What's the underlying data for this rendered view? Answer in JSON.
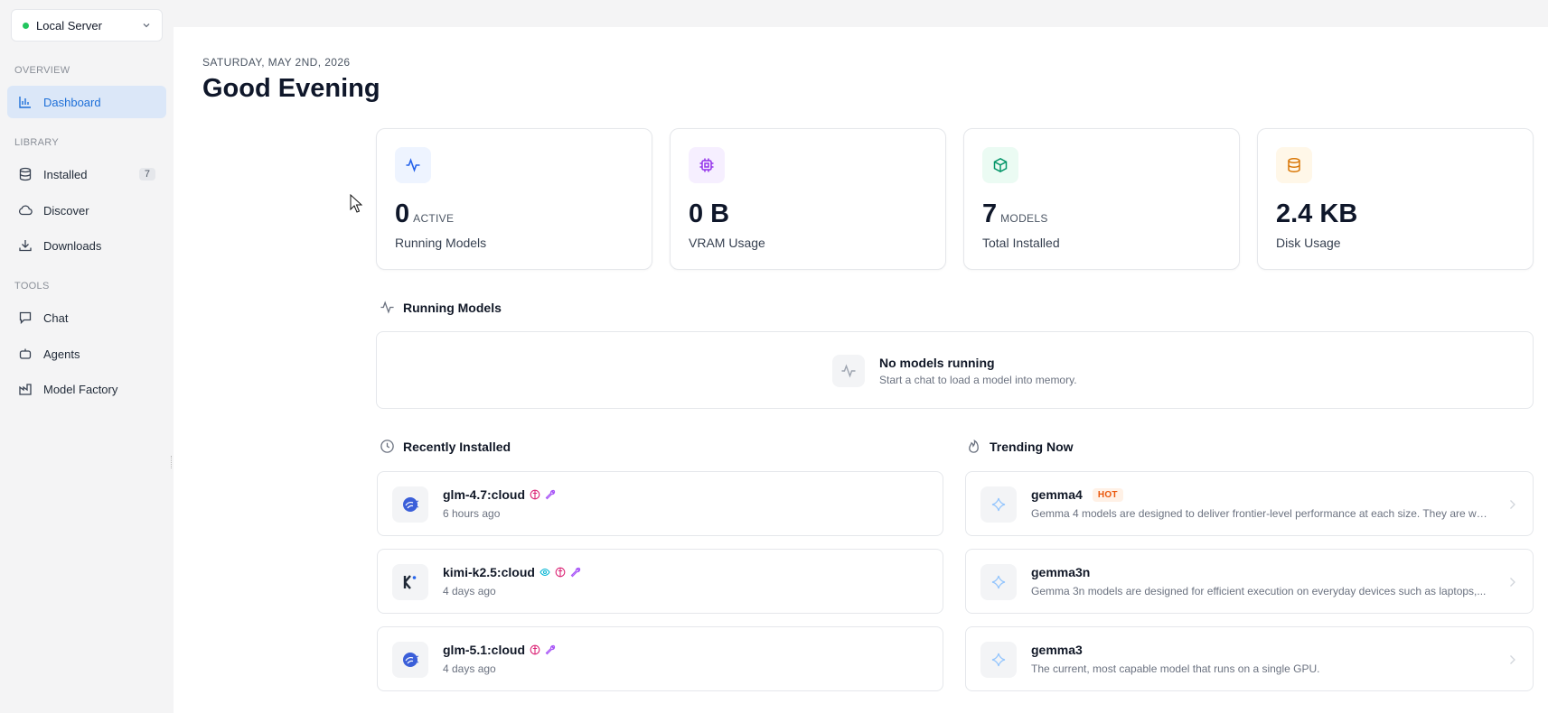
{
  "server": {
    "name": "Local Server",
    "status_color": "#22c55e"
  },
  "sidebar": {
    "sections": [
      {
        "title": "OVERVIEW"
      },
      {
        "title": "LIBRARY"
      },
      {
        "title": "TOOLS"
      }
    ],
    "items": [
      {
        "label": "Dashboard",
        "icon": "chart-bar-icon",
        "active": true
      },
      {
        "label": "Installed",
        "icon": "database-icon",
        "count": "7"
      },
      {
        "label": "Discover",
        "icon": "cloud-icon"
      },
      {
        "label": "Downloads",
        "icon": "download-icon"
      },
      {
        "label": "Chat",
        "icon": "message-icon"
      },
      {
        "label": "Agents",
        "icon": "bot-icon"
      },
      {
        "label": "Model Factory",
        "icon": "factory-icon"
      }
    ]
  },
  "header": {
    "date": "SATURDAY, MAY 2ND, 2026",
    "greeting": "Good Evening"
  },
  "stats": [
    {
      "value": "0",
      "unit": "ACTIVE",
      "label": "Running Models",
      "icon": "activity-icon",
      "color": "#2563eb",
      "bg": "#eef4ff"
    },
    {
      "value": "0 B",
      "unit": "",
      "label": "VRAM Usage",
      "icon": "chip-icon",
      "color": "#9333ea",
      "bg": "#f6efff"
    },
    {
      "value": "7",
      "unit": "MODELS",
      "label": "Total Installed",
      "icon": "box-icon",
      "color": "#059669",
      "bg": "#ebfbf3"
    },
    {
      "value": "2.4 KB",
      "unit": "",
      "label": "Disk Usage",
      "icon": "database-icon",
      "color": "#d97706",
      "bg": "#fff7e8"
    }
  ],
  "running": {
    "title": "Running Models",
    "empty_title": "No models running",
    "empty_subtitle": "Start a chat to load a model into memory."
  },
  "recent": {
    "title": "Recently Installed",
    "items": [
      {
        "name": "glm-4.7:cloud",
        "time": "6 hours ago",
        "icon": "glm-logo-icon"
      },
      {
        "name": "kimi-k2.5:cloud",
        "time": "4 days ago",
        "icon": "kimi-logo-icon"
      },
      {
        "name": "glm-5.1:cloud",
        "time": "4 days ago",
        "icon": "glm-logo-icon"
      }
    ]
  },
  "trending": {
    "title": "Trending Now",
    "hot_label": "HOT",
    "items": [
      {
        "name": "gemma4",
        "hot": true,
        "description": "Gemma 4 models are designed to deliver frontier-level performance at each size. They are wel..."
      },
      {
        "name": "gemma3n",
        "description": "Gemma 3n models are designed for efficient execution on everyday devices such as laptops,..."
      },
      {
        "name": "gemma3",
        "description": "The current, most capable model that runs on a single GPU."
      }
    ]
  }
}
